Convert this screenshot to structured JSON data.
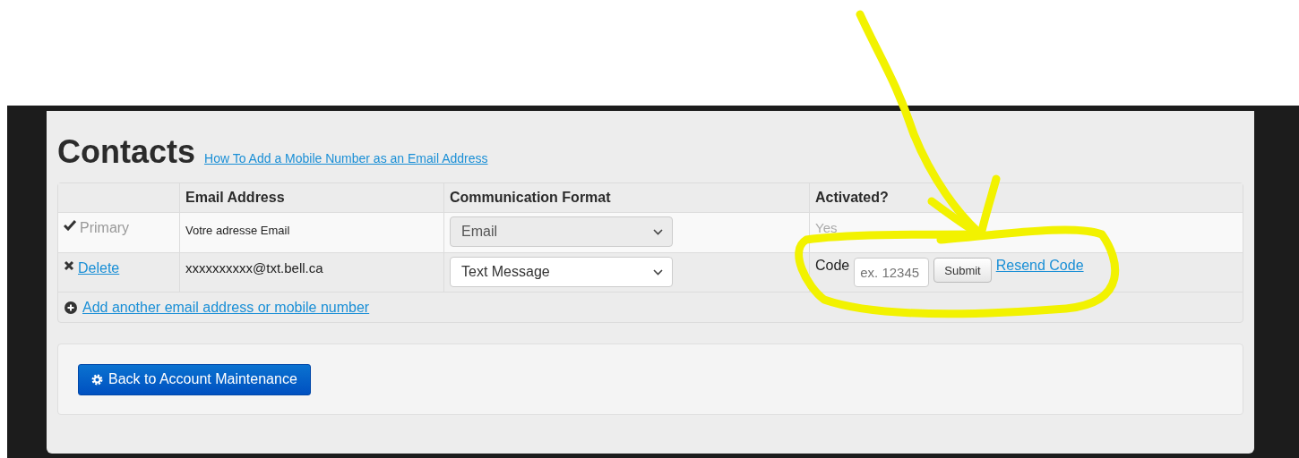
{
  "title": "Contacts",
  "help_link": "How To Add a Mobile Number as an Email Address",
  "table": {
    "columns": [
      "Email Address",
      "Communication Format",
      "Activated?"
    ],
    "rows": [
      {
        "kind": "primary",
        "label": "Primary",
        "email": "Votre adresse Email",
        "format": {
          "value": "Email",
          "disabled": true
        },
        "activated": "Yes"
      },
      {
        "kind": "pending",
        "label": "Delete",
        "email": "xxxxxxxxxx@txt.bell.ca",
        "format": {
          "value": "Text Message",
          "disabled": false
        },
        "code": {
          "label": "Code",
          "placeholder": "ex. 12345",
          "submit": "Submit",
          "resend": "Resend Code"
        }
      }
    ]
  },
  "add_link": "Add another email address or mobile number",
  "back_button": "Back to Account Maintenance"
}
